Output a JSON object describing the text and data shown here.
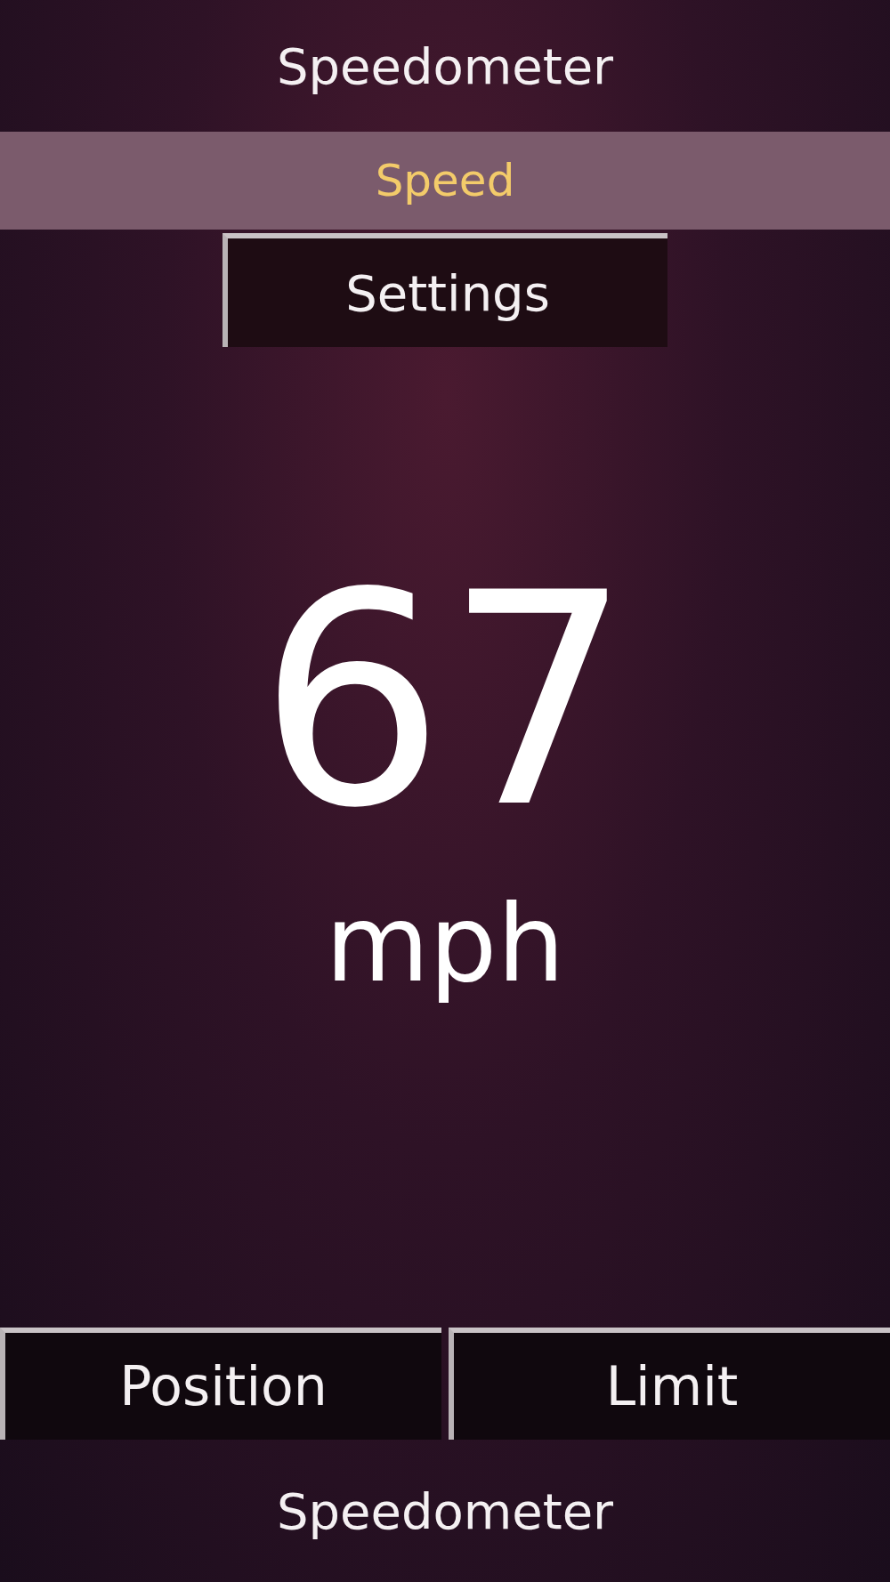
{
  "title": "Speedometer",
  "tabs": [
    {
      "label": "Speed",
      "selected": true
    }
  ],
  "settings_button": "Settings",
  "speed": {
    "value": "67",
    "unit": "mph"
  },
  "bottom_buttons": [
    "Position",
    "Limit"
  ],
  "footer_title": "Speedometer"
}
